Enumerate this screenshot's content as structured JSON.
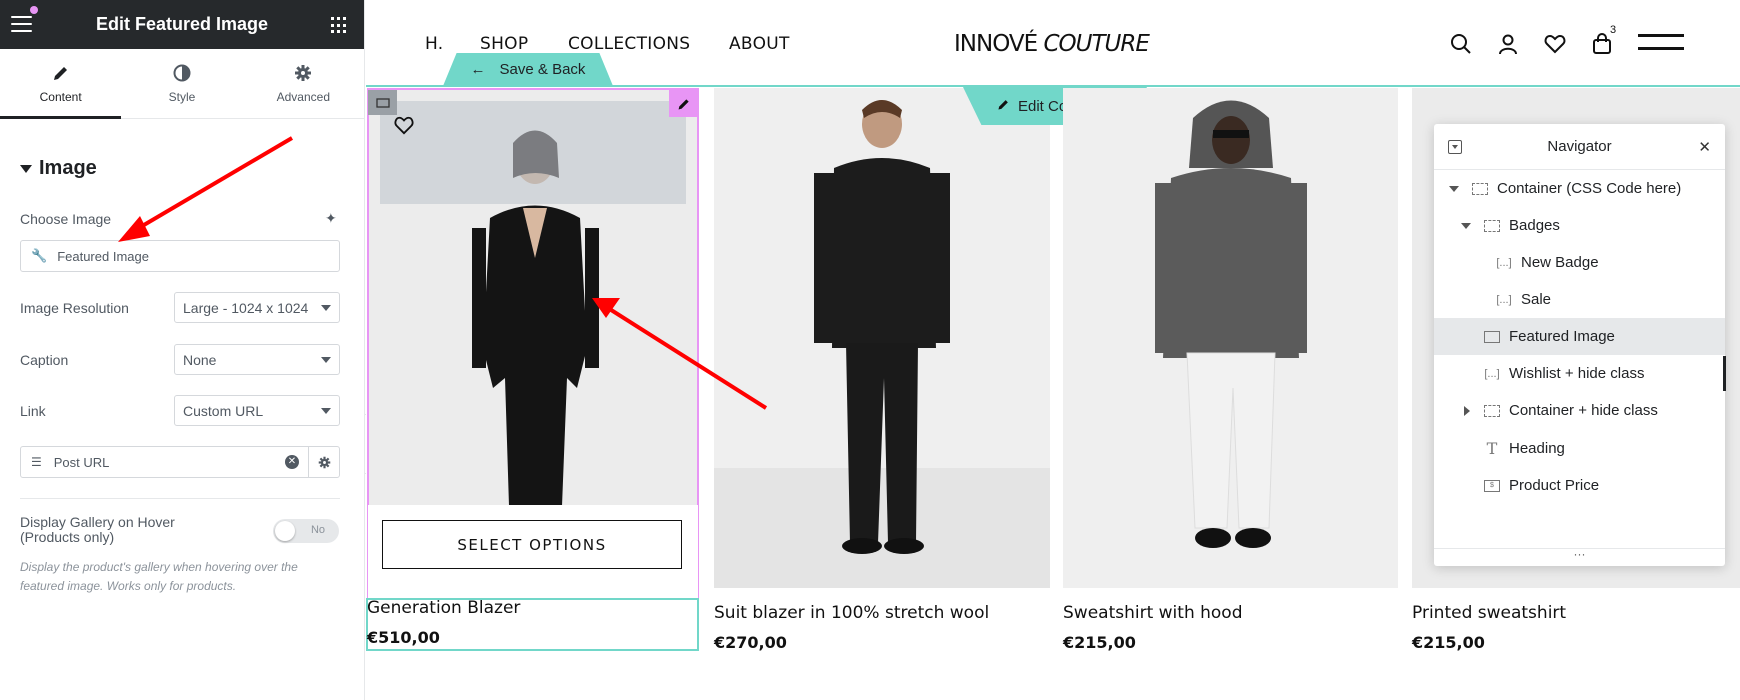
{
  "panel": {
    "title": "Edit Featured Image",
    "tabs": [
      {
        "label": "Content",
        "icon": "pencil-icon"
      },
      {
        "label": "Style",
        "icon": "half-circle-icon"
      },
      {
        "label": "Advanced",
        "icon": "gear-icon"
      }
    ],
    "section": "Image",
    "choose_image_label": "Choose Image",
    "choose_image_value": "Featured Image",
    "resolution_label": "Image Resolution",
    "resolution_value": "Large - 1024 x 1024",
    "caption_label": "Caption",
    "caption_value": "None",
    "link_label": "Link",
    "link_value": "Custom URL",
    "dynamic_value": "Post URL",
    "gallery_label": "Display Gallery on Hover\n(Products only)",
    "gallery_toggle": "No",
    "help_text": "Display the product's gallery when hovering over the featured image. Works only for products."
  },
  "site": {
    "nav": [
      "H.",
      "SHOP",
      "COLLECTIONS",
      "ABOUT"
    ],
    "logo_a": "INNOVÉ",
    "logo_b": "COUTURE",
    "cart_count": "3",
    "save_back": "Save & Back",
    "edit_container": "Edit Container",
    "select_options": "SELECT OPTIONS",
    "products": [
      {
        "name": "Generation Blazer",
        "price": "€510,00"
      },
      {
        "name": "Suit blazer in 100% stretch wool",
        "price": "€270,00"
      },
      {
        "name": "Sweatshirt with hood",
        "price": "€215,00"
      },
      {
        "name": "Printed sweatshirt",
        "price": "€215,00"
      }
    ]
  },
  "navigator": {
    "title": "Navigator",
    "items": [
      {
        "label": "Container (CSS Code here)",
        "icon": "container-icon",
        "expanded": true
      },
      {
        "label": "Badges",
        "icon": "container-icon",
        "expanded": true
      },
      {
        "label": "New Badge",
        "icon": "shortcode-icon"
      },
      {
        "label": "Sale",
        "icon": "shortcode-icon"
      },
      {
        "label": "Featured Image",
        "icon": "image-icon",
        "active": true
      },
      {
        "label": "Wishlist + hide class",
        "icon": "shortcode-icon"
      },
      {
        "label": "Container + hide class",
        "icon": "container-icon",
        "collapsed": true
      },
      {
        "label": "Heading",
        "icon": "heading-icon"
      },
      {
        "label": "Product Price",
        "icon": "price-icon"
      }
    ]
  },
  "colors": {
    "accent_teal": "#71d7c9",
    "accent_pink": "#e895f5",
    "arrow_red": "#ff0000",
    "panel_dark": "#26292c"
  }
}
